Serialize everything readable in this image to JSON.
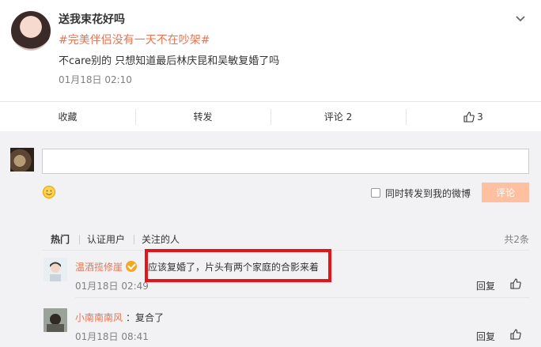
{
  "post": {
    "author": "送我束花好吗",
    "topic": "#完美伴侣没有一天不在吵架#",
    "content": "不care别的 只想知道最后林庆昆和吴敏复婚了吗",
    "time": "01月18日 02:10"
  },
  "actions": {
    "favorite": "收藏",
    "forward": "转发",
    "comment": "评论 2",
    "like": "3"
  },
  "composer": {
    "forward_option": "同时转发到我的微博",
    "submit": "评论"
  },
  "tabs": {
    "hot": "热门",
    "verified": "认证用户",
    "following": "关注的人",
    "total": "共2条"
  },
  "comments": [
    {
      "user": "温酒揽修崖",
      "verified": true,
      "text": "应该复婚了，片头有两个家庭的合影来着",
      "time": "01月18日 02:49",
      "reply": "回复"
    },
    {
      "user": "小南南南风",
      "verified": false,
      "text": "：复合了",
      "time": "01月18日 08:41",
      "reply": "回复"
    }
  ],
  "colors": {
    "accent": "#eb7350",
    "highlight": "#e5141a",
    "submit_bg": "#ffc09f"
  }
}
